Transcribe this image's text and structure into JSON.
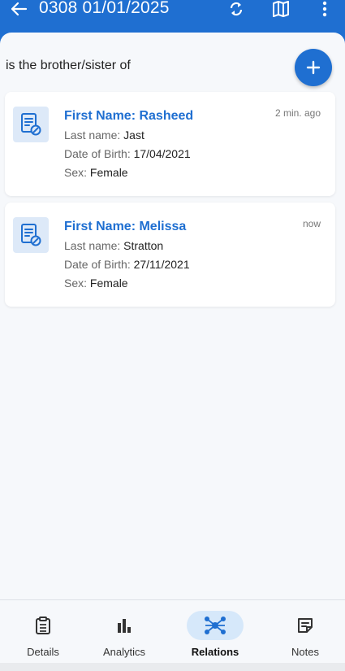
{
  "header": {
    "title": "0308 01/01/2025"
  },
  "section": {
    "title": "is the brother/sister of"
  },
  "cards": [
    {
      "name": "First Name: Rasheed",
      "last_name_label": "Last name:",
      "last_name": "Jast",
      "dob_label": "Date of Birth:",
      "dob": "17/04/2021",
      "sex_label": "Sex:",
      "sex": "Female",
      "time": "2 min. ago"
    },
    {
      "name": "First Name: Melissa",
      "last_name_label": "Last name:",
      "last_name": "Stratton",
      "dob_label": "Date of Birth:",
      "dob": "27/11/2021",
      "sex_label": "Sex:",
      "sex": "Female",
      "time": "now"
    }
  ],
  "nav": {
    "items": [
      {
        "label": "Details",
        "icon": "clipboard-icon"
      },
      {
        "label": "Analytics",
        "icon": "bar-chart-icon"
      },
      {
        "label": "Relations",
        "icon": "relations-icon",
        "active": true
      },
      {
        "label": "Notes",
        "icon": "notes-icon"
      }
    ]
  },
  "colors": {
    "primary": "#1f6fd1",
    "active_pill": "#d6e8fa"
  }
}
